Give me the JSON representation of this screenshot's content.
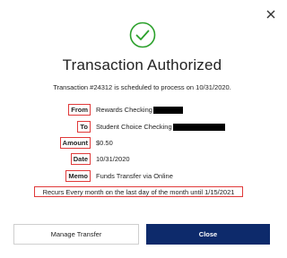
{
  "dialog": {
    "title": "Transaction Authorized",
    "subtitle": "Transaction #24312 is scheduled to process on 10/31/2020.",
    "icons": {
      "close": "close-icon",
      "status": "check-circle-icon"
    },
    "colors": {
      "success": "#2aa02a",
      "highlight": "#e03a3a",
      "primary_button": "#0d2a6b"
    }
  },
  "details": {
    "from": {
      "label": "From",
      "value": "Rewards Checking"
    },
    "to": {
      "label": "To",
      "value": "Student Choice Checking"
    },
    "amount": {
      "label": "Amount",
      "value": "$0.50"
    },
    "date": {
      "label": "Date",
      "value": "10/31/2020"
    },
    "memo": {
      "label": "Memo",
      "value": "Funds Transfer via Online"
    }
  },
  "recurrence": "Recurs Every month on the last day of the month until 1/15/2021",
  "buttons": {
    "manage": "Manage Transfer",
    "close": "Close"
  }
}
